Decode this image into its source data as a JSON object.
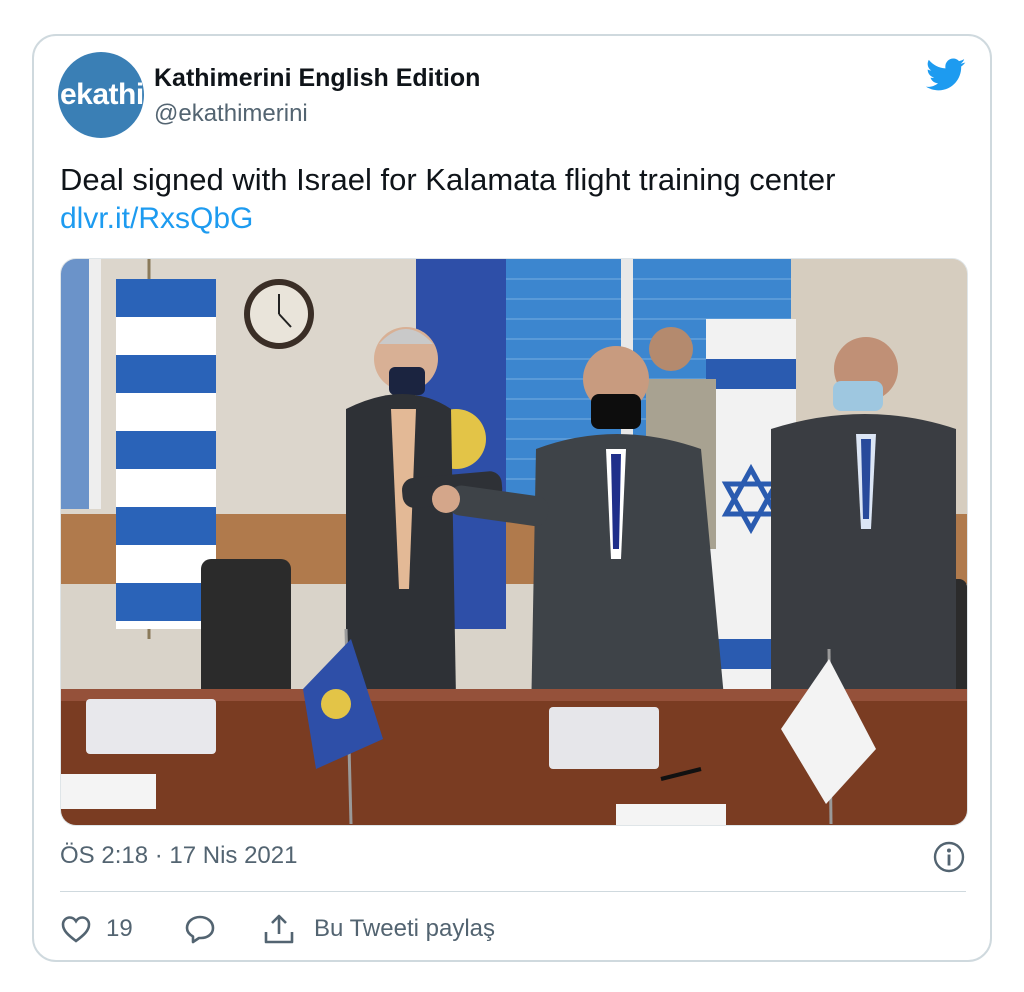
{
  "tweet": {
    "author_name": "Kathimerini English Edition",
    "author_handle": "@ekathimerini",
    "avatar_text": "ekathi",
    "text": "Deal signed with Israel for Kalamata flight training center",
    "link": "dlvr.it/RxsQbG",
    "timestamp": "ÖS 2:18 · 17 Nis 2021",
    "like_count": "19",
    "share_label": "Bu Tweeti paylaş"
  },
  "icons": {
    "platform": "twitter-bird-icon",
    "info": "info-icon",
    "like": "heart-icon",
    "reply": "reply-icon",
    "share": "share-icon"
  },
  "colors": {
    "accent": "#1d9bf0",
    "secondary_text": "#536471",
    "border": "#cfd9de",
    "avatar_bg": "#3a7fb5"
  }
}
